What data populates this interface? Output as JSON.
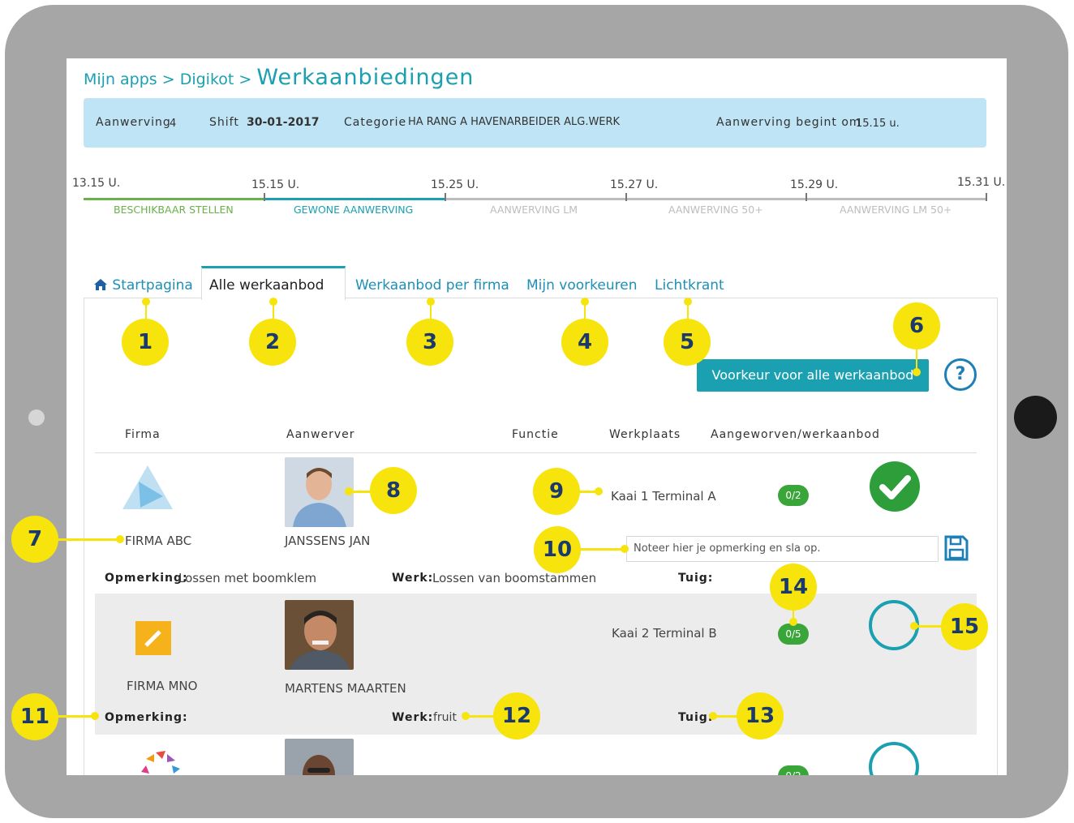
{
  "breadcrumb": {
    "prefix": "Mijn apps > Digikot >",
    "title": "Werkaanbiedingen"
  },
  "info": {
    "aanwerving_label": "Aanwerving",
    "aanwerving_value": "4",
    "shift_label": "Shift",
    "shift_value": "30-01-2017",
    "categorie_label": "Categorie",
    "categorie_value": "HA RANG A HAVENARBEIDER ALG.WERK",
    "begint_label": "Aanwerving begint om",
    "begint_value": "15.15 u."
  },
  "timeline": {
    "times": [
      "13.15 U.",
      "15.15 U.",
      "15.25 U.",
      "15.27 U.",
      "15.29 U.",
      "15.31 U."
    ],
    "phases": [
      "BESCHIKBAAR STELLEN",
      "GEWONE AANWERVING",
      "AANWERVING LM",
      "AANWERVING 50+",
      "AANWERVING LM 50+"
    ],
    "colors": {
      "done": "#6ab04c",
      "current": "#1aa0b0",
      "pending": "#bdbdbd"
    }
  },
  "tabs": [
    "Startpagina",
    "Alle werkaanbod",
    "Werkaanbod per firma",
    "Mijn voorkeuren",
    "Lichtkrant"
  ],
  "preference_button": "Voorkeur voor alle werkaanbod",
  "help_icon": "?",
  "table": {
    "headers": [
      "Firma",
      "Aanwerver",
      "Functie",
      "Werkplaats",
      "Aangeworven/werkaanbod"
    ],
    "rows": [
      {
        "firma": "FIRMA ABC",
        "aanwerver": "JANSSENS JAN",
        "werkplaats": "Kaai 1 Terminal A",
        "count": "0/2",
        "status": "checked",
        "opmerking_label": "Opmerking:",
        "opmerking": "Lossen met boomklem",
        "werk_label": "Werk:",
        "werk": "Lossen van boomstammen",
        "tuig_label": "Tuig:",
        "tuig": ""
      },
      {
        "firma": "FIRMA MNO",
        "aanwerver": "MARTENS MAARTEN",
        "werkplaats": "Kaai 2 Terminal B",
        "count": "0/5",
        "status": "unchecked",
        "opmerking_label": "Opmerking:",
        "opmerking": "",
        "werk_label": "Werk:",
        "werk": "fruit",
        "tuig_label": "Tuig:",
        "tuig": ""
      },
      {
        "count": "0/2"
      }
    ]
  },
  "note_placeholder": "Noteer hier je opmerking en sla op.",
  "callouts": [
    "1",
    "2",
    "3",
    "4",
    "5",
    "6",
    "7",
    "8",
    "9",
    "10",
    "11",
    "12",
    "13",
    "14",
    "15"
  ]
}
